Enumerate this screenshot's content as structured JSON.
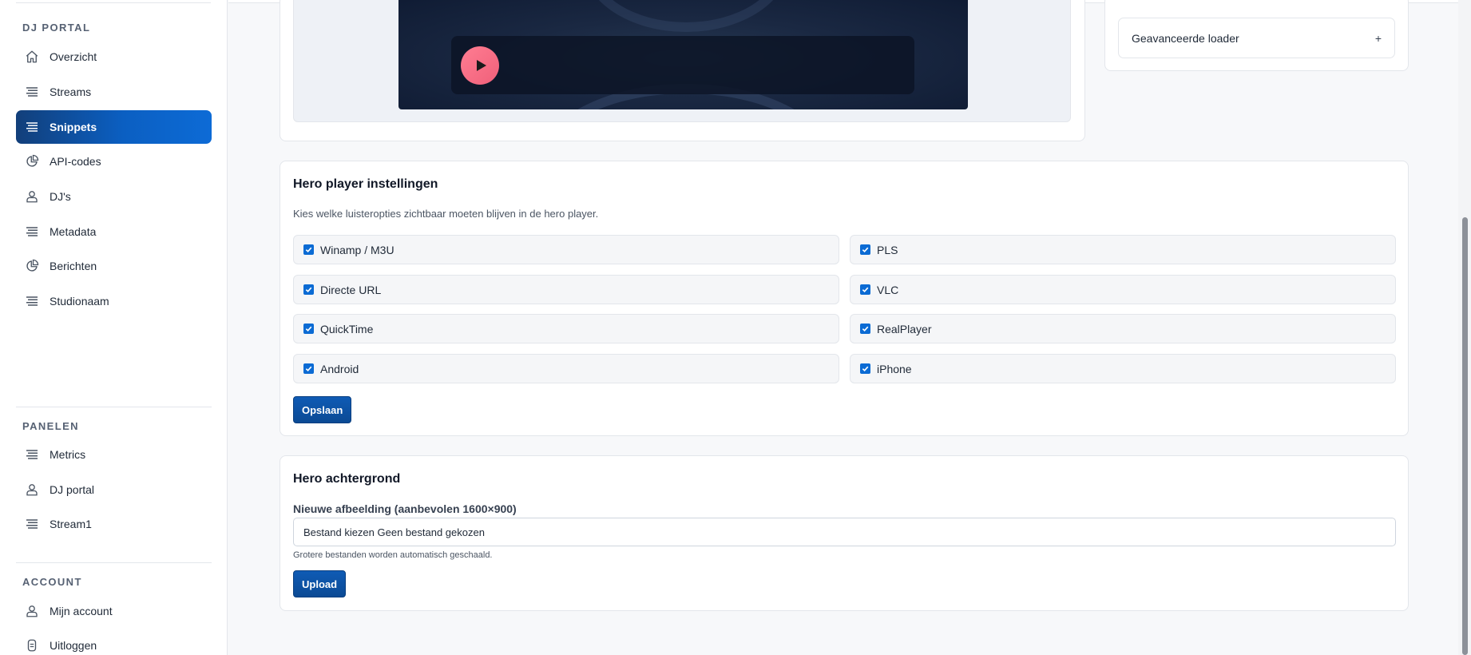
{
  "sidebar": {
    "sections": [
      {
        "title": "DJ PORTAL",
        "items": [
          {
            "label": "Overzicht",
            "icon": "home-icon",
            "active": false
          },
          {
            "label": "Streams",
            "icon": "lines-icon",
            "active": false
          },
          {
            "label": "Snippets",
            "icon": "lines-icon",
            "active": true
          },
          {
            "label": "API-codes",
            "icon": "pie-chart-icon",
            "active": false
          },
          {
            "label": "DJ's",
            "icon": "user-icon",
            "active": false
          },
          {
            "label": "Metadata",
            "icon": "lines-icon",
            "active": false
          },
          {
            "label": "Berichten",
            "icon": "pie-chart-icon",
            "active": false
          },
          {
            "label": "Studionaam",
            "icon": "lines-icon",
            "active": false
          }
        ]
      },
      {
        "title": "PANELEN",
        "items": [
          {
            "label": "Metrics",
            "icon": "lines-icon",
            "active": false
          },
          {
            "label": "DJ portal",
            "icon": "user-icon",
            "active": false
          },
          {
            "label": "Stream1",
            "icon": "lines-icon",
            "active": false
          }
        ]
      },
      {
        "title": "ACCOUNT",
        "items": [
          {
            "label": "Mijn account",
            "icon": "user-icon",
            "active": false
          },
          {
            "label": "Uitloggen",
            "icon": "logout-icon",
            "active": false
          }
        ]
      }
    ]
  },
  "player_preview": {
    "play_icon": "play-icon"
  },
  "advanced": {
    "label": "Geavanceerde loader",
    "toggle": "+"
  },
  "hero_settings": {
    "title": "Hero player instellingen",
    "description": "Kies welke luisteropties zichtbaar moeten blijven in de hero player.",
    "options": [
      {
        "label": "Winamp / M3U",
        "checked": true
      },
      {
        "label": "PLS",
        "checked": true
      },
      {
        "label": "Directe URL",
        "checked": true
      },
      {
        "label": "VLC",
        "checked": true
      },
      {
        "label": "QuickTime",
        "checked": true
      },
      {
        "label": "RealPlayer",
        "checked": true
      },
      {
        "label": "Android",
        "checked": true
      },
      {
        "label": "iPhone",
        "checked": true
      }
    ],
    "save_label": "Opslaan"
  },
  "hero_background": {
    "title": "Hero achtergrond",
    "field_label": "Nieuwe afbeelding (aanbevolen 1600×900)",
    "file_value": "Bestand kiezen Geen bestand gekozen",
    "hint": "Grotere bestanden worden automatisch geschaald.",
    "upload_label": "Upload"
  },
  "colors": {
    "accent": "#0b5fc2",
    "play": "#f0607a",
    "checkbox": "#0b6bd4"
  }
}
